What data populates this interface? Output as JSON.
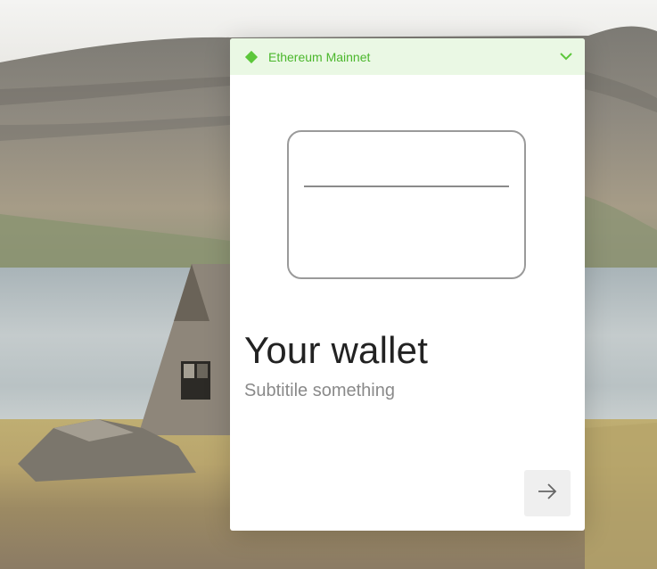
{
  "network": {
    "label": "Ethereum Mainnet",
    "accent": "#5cc73a",
    "icon": "diamond-icon",
    "dropdown_icon": "chevron-down-icon"
  },
  "wallet": {
    "title": "Your wallet",
    "subtitle": "Subtitile something"
  },
  "next_button": {
    "icon": "arrow-right-icon"
  }
}
